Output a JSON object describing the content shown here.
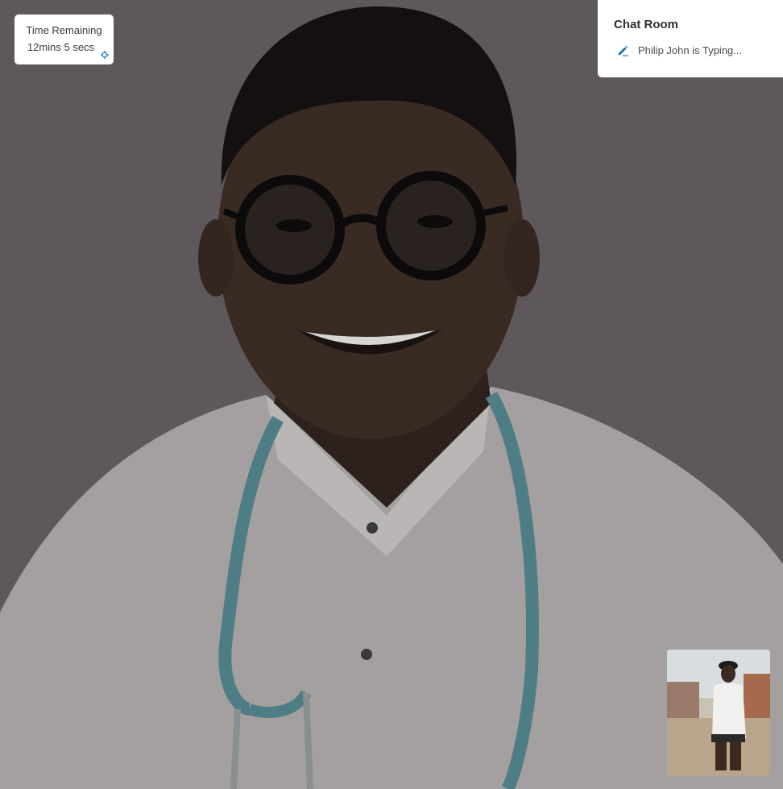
{
  "timer": {
    "title": "Time Remaining",
    "value": "12mins 5 secs",
    "icon": "crosshair-icon"
  },
  "chat": {
    "title": "Chat Room",
    "typing_status": "Philip John is Typing...",
    "typing_icon": "pen-icon"
  },
  "colors": {
    "accent": "#1f6fb8",
    "overlay": "#5f595b",
    "panel": "#ffffff"
  }
}
